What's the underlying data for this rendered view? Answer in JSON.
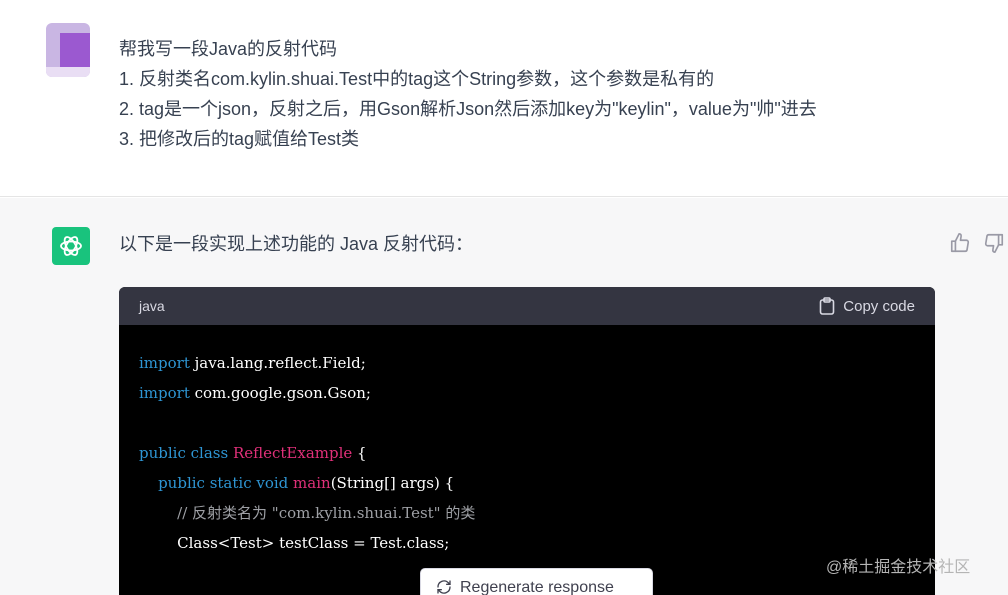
{
  "user_message": {
    "lines": [
      "帮我写一段Java的反射代码",
      "1. 反射类名com.kylin.shuai.Test中的tag这个String参数，这个参数是私有的",
      "2. tag是一个json，反射之后，用Gson解析Json然后添加key为\"keylin\"，value为\"帅\"进去",
      "3. 把修改后的tag赋值给Test类"
    ]
  },
  "assistant": {
    "intro": "以下是一段实现上述功能的 Java 反射代码：",
    "icons": {
      "avatar": "openai-logo-icon",
      "like": "thumbs-up-icon",
      "dislike": "thumbs-down-icon"
    }
  },
  "code_block": {
    "language": "java",
    "copy_label": "Copy code",
    "lines": [
      {
        "k": "import",
        "r": " java.lang.reflect.Field;"
      },
      {
        "k": "import",
        "r": " com.google.gson.Gson;"
      },
      {
        "r": ""
      },
      {
        "k": "public class",
        "c": " ReflectExample",
        "r": " {"
      },
      {
        "i": "    ",
        "k": "public static void",
        "c": " main",
        "r": "(String[] args) {"
      },
      {
        "i": "        ",
        "m": "// 反射类名为 \"com.kylin.shuai.Test\" 的类"
      },
      {
        "i": "        ",
        "r": "Class<Test> testClass = Test.class;"
      }
    ]
  },
  "regenerate_label": "Regenerate response",
  "watermark": "@稀土掘金技术社区",
  "colors": {
    "accent": "#19c37d",
    "keyword": "#2e95d3",
    "classname": "#df3079",
    "comment": "#9ea0a5"
  }
}
